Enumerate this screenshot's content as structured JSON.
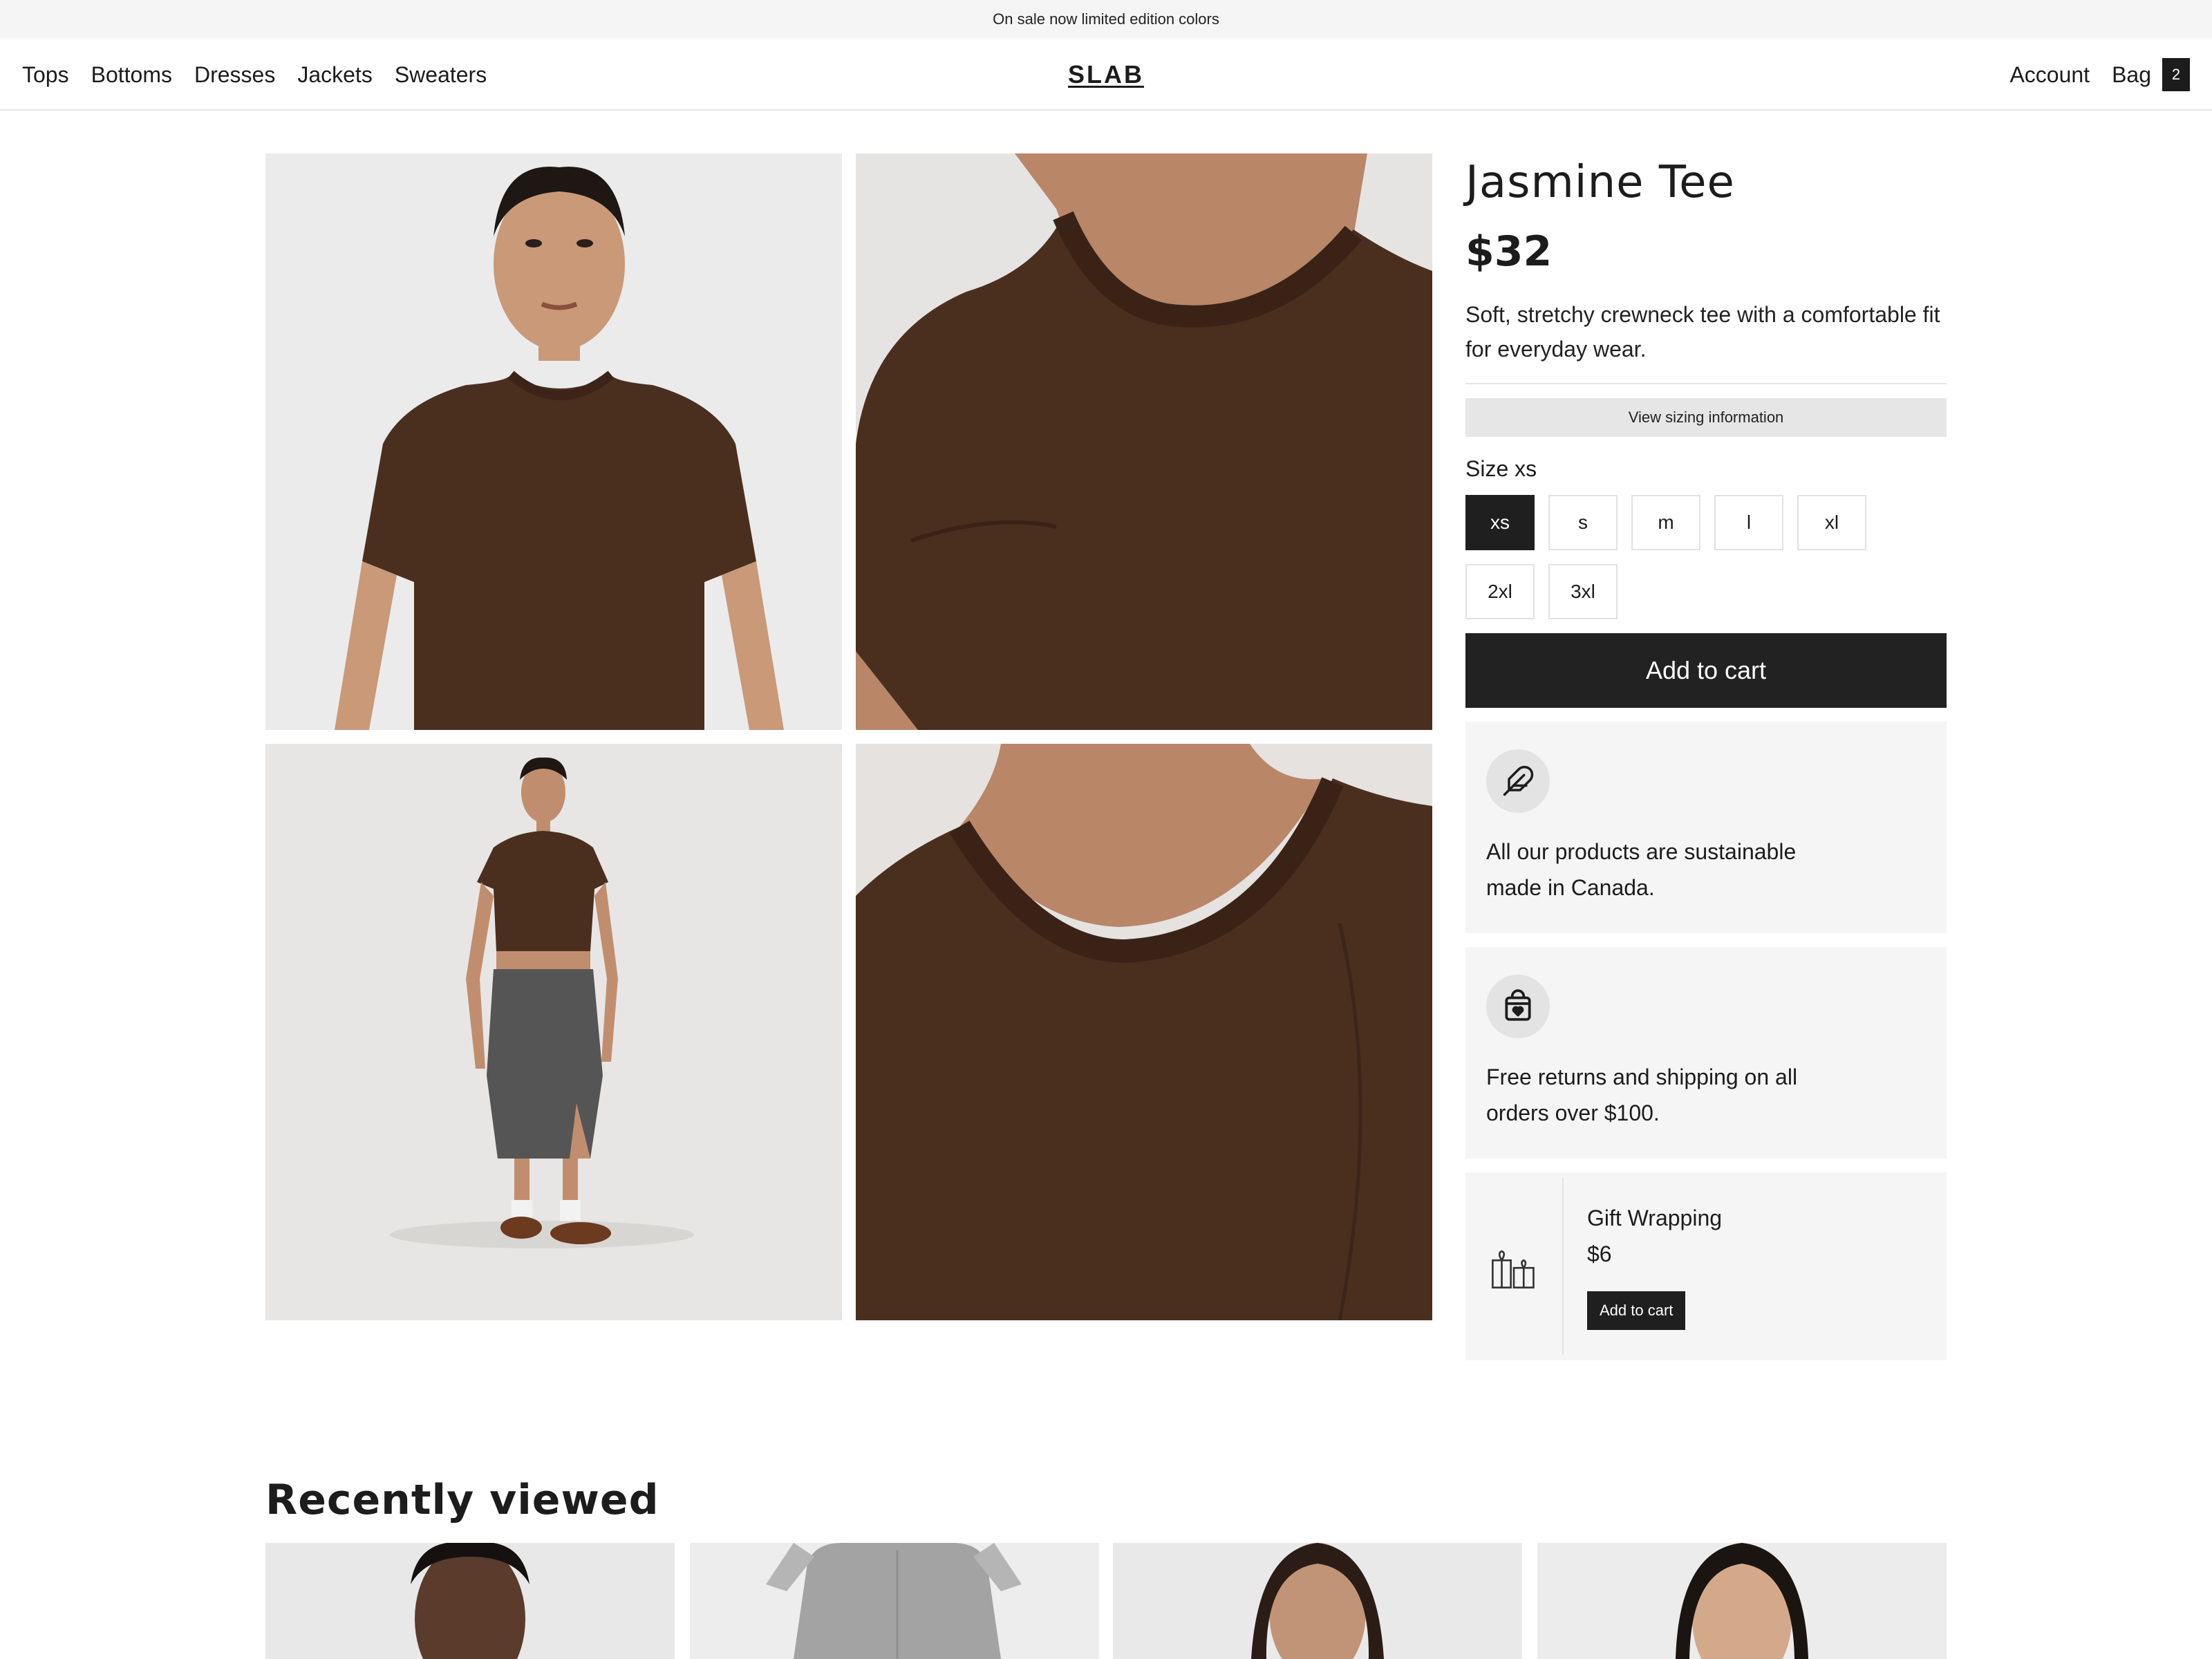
{
  "announcement": "On sale now limited edition colors",
  "header": {
    "nav": [
      "Tops",
      "Bottoms",
      "Dresses",
      "Jackets",
      "Sweaters"
    ],
    "logo": "SLAB",
    "account": "Account",
    "bag": "Bag",
    "bag_count": "2"
  },
  "gallery": {
    "images": [
      "model-front-brown-tee",
      "neckline-closeup-shoulder",
      "model-full-body-skirt",
      "neckline-closeup-collar"
    ]
  },
  "product": {
    "title": "Jasmine Tee",
    "price": "$32",
    "description": "Soft, stretchy crewneck tee with a comfortable fit for everyday wear.",
    "sizing_button": "View sizing information",
    "size_label": "Size xs",
    "sizes": [
      "xs",
      "s",
      "m",
      "l",
      "xl",
      "2xl",
      "3xl"
    ],
    "selected_size": "xs",
    "add_to_cart": "Add to cart"
  },
  "features": [
    {
      "icon": "feather-icon",
      "text": "All our products are sustainable made in Canada."
    },
    {
      "icon": "shopping-bag-heart-icon",
      "text": "Free returns and shipping on all orders over $100."
    }
  ],
  "gift": {
    "icon": "gift-box-icon",
    "name": "Gift Wrapping",
    "price": "$6",
    "button": "Add to cart"
  },
  "recently_viewed": {
    "title": "Recently viewed",
    "items": [
      "product-thumbnail",
      "product-thumbnail",
      "product-thumbnail",
      "product-thumbnail"
    ]
  },
  "colors": {
    "tee_brown": "#4a2f1f",
    "dark_button": "#222222",
    "panel_gray": "#f5f5f5",
    "announcement_bg": "#f5f5f5"
  }
}
